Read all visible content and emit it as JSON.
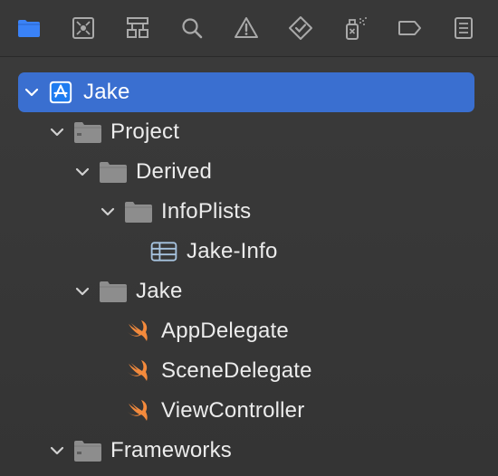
{
  "toolbar": {
    "tabs": [
      {
        "name": "folder-icon",
        "active": true
      },
      {
        "name": "source-control-icon",
        "active": false
      },
      {
        "name": "hierarchy-icon",
        "active": false
      },
      {
        "name": "search-icon",
        "active": false
      },
      {
        "name": "warning-icon",
        "active": false
      },
      {
        "name": "test-diamond-icon",
        "active": false
      },
      {
        "name": "debug-spray-icon",
        "active": false
      },
      {
        "name": "breakpoint-tag-icon",
        "active": false
      },
      {
        "name": "report-list-icon",
        "active": false
      }
    ],
    "active_color": "#3a82f7",
    "inactive_color": "#a9a9a9"
  },
  "tree": {
    "selected_color": "#3a6fd0",
    "items": [
      {
        "label": "Jake",
        "icon": "app-project-icon",
        "expanded": true,
        "selected": true
      },
      {
        "label": "Project",
        "icon": "folder-icon",
        "expanded": true
      },
      {
        "label": "Derived",
        "icon": "folder-icon",
        "expanded": true
      },
      {
        "label": "InfoPlists",
        "icon": "folder-icon",
        "expanded": true
      },
      {
        "label": "Jake-Info",
        "icon": "plist-table-icon"
      },
      {
        "label": "Jake",
        "icon": "folder-icon",
        "expanded": true
      },
      {
        "label": "AppDelegate",
        "icon": "swift-icon"
      },
      {
        "label": "SceneDelegate",
        "icon": "swift-icon"
      },
      {
        "label": "ViewController",
        "icon": "swift-icon"
      },
      {
        "label": "Frameworks",
        "icon": "folder-icon",
        "expanded": true
      }
    ]
  }
}
